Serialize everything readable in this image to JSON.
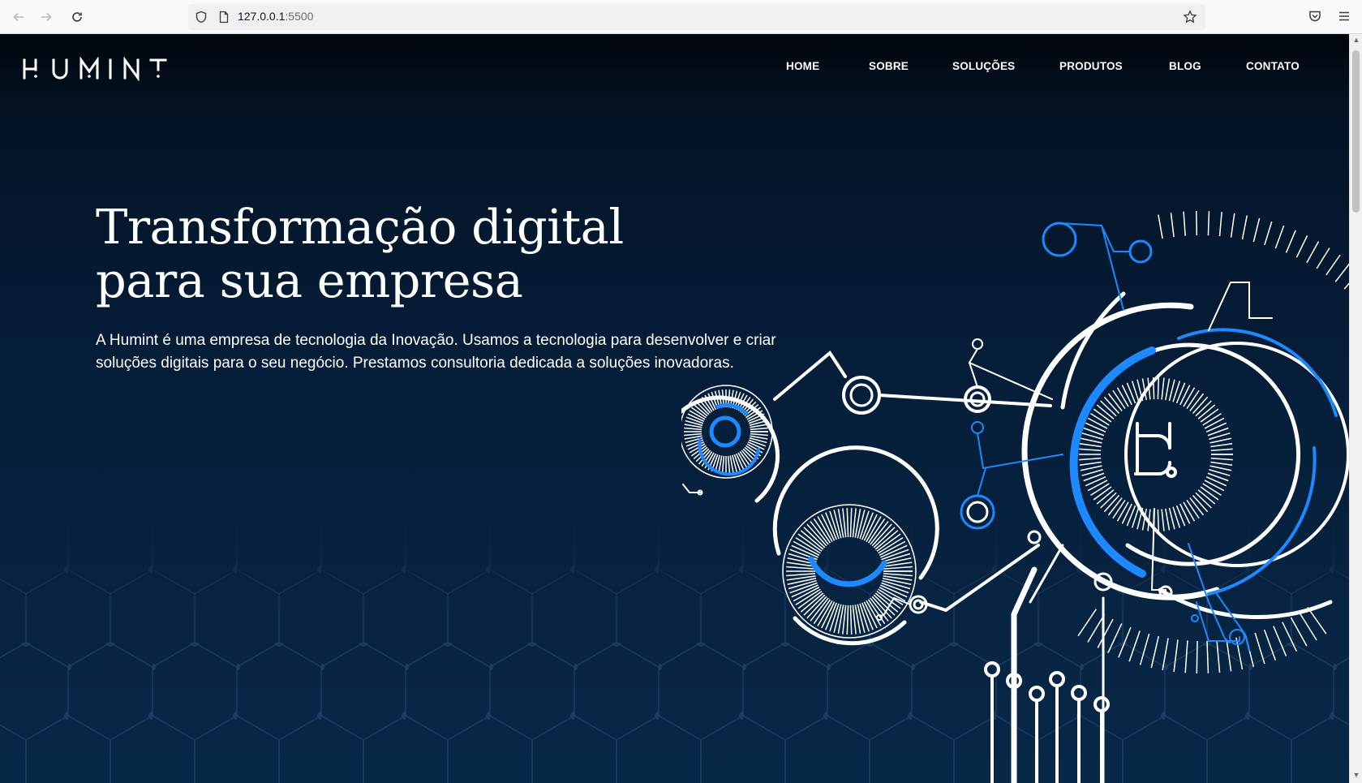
{
  "browser": {
    "url_host": "127.0.0.1",
    "url_port": ":5500",
    "icons": [
      "back-arrow-icon",
      "forward-arrow-icon",
      "reload-icon",
      "shield-icon",
      "page-icon",
      "bookmark-star-icon",
      "pocket-icon",
      "menu-icon"
    ]
  },
  "header": {
    "logo_text": "HUMINT",
    "nav": [
      "HOME",
      "SOBRE",
      "SOLUÇÕES",
      "PRODUTOS",
      "BLOG",
      "CONTATO"
    ]
  },
  "hero": {
    "title_line1": "Transformação digital",
    "title_line2": "para sua empresa",
    "text_line1": "A Humint é uma empresa de tecnologia da Inovação. Usamos a tecnologia para desenvolver e criar",
    "text_line2": "soluções digitais para o seu negócio. Prestamos consultoria dedicada a soluções inovadoras."
  },
  "colors": {
    "accent_blue": "#1e88ff",
    "background_dark": "#061e39",
    "text": "#ffffff"
  }
}
